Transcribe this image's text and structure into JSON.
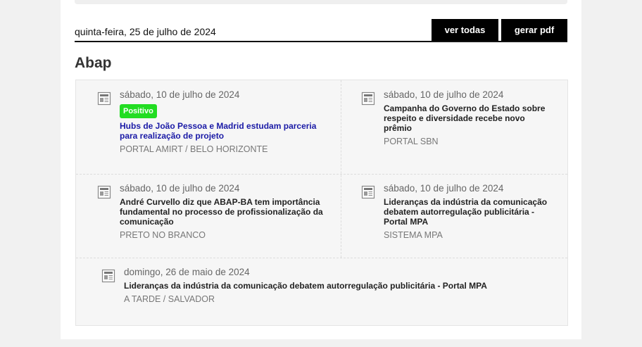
{
  "header": {
    "date": "quinta-feira, 25 de julho de 2024",
    "view_all_label": "ver todas",
    "pdf_label": "gerar pdf"
  },
  "section": {
    "title": "Abap"
  },
  "items": [
    {
      "date": "sábado, 10 de julho de 2024",
      "badge": "Positivo",
      "headline": "Hubs de João Pessoa e Madrid estudam parceria para realização de projeto",
      "source": "PORTAL AMIRT / BELO HORIZONTE",
      "icon": "newspaper-icon"
    },
    {
      "date": "sábado, 10 de julho de 2024",
      "headline": "Campanha do Governo do Estado sobre respeito e diversidade recebe novo prêmio",
      "source": "PORTAL SBN",
      "icon": "newspaper-icon"
    },
    {
      "date": "sábado, 10 de julho de 2024",
      "headline": "André Curvello diz que ABAP-BA tem importância fundamental no processo de profissionalização da comunicação",
      "source": "PRETO NO BRANCO",
      "icon": "newspaper-icon"
    },
    {
      "date": "sábado, 10 de julho de 2024",
      "headline": "Lideranças da indústria da comunicação debatem autorregulação publicitária - Portal MPA",
      "source": "SISTEMA MPA",
      "icon": "newspaper-icon"
    },
    {
      "date": "domingo, 26 de maio de 2024",
      "headline": "Lideranças da indústria da comunicação debatem autorregulação publicitária - Portal MPA",
      "source": "A TARDE / SALVADOR",
      "icon": "newspaper-icon"
    }
  ],
  "colors": {
    "badge_positive": "#22dd22",
    "link": "#1a1aa6",
    "button_bg": "#000000"
  }
}
